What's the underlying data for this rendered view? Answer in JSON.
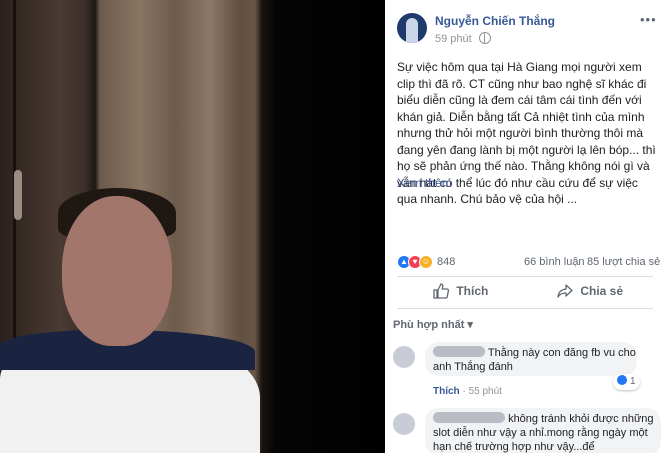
{
  "post": {
    "author": "Nguyễn Chiến Thắng",
    "time": "59 phút",
    "more_icon": "ellipsis-icon",
    "text": "Sự việc hôm qua tại Hà Giang mọi người xem clip thì đã rõ. CT cũng như bao nghệ sĩ khác đi biểu diễn cũng là đem cái tâm cái tình đến với khán giả. Diễn bằng tất Cả nhiệt tình của mình nhưng thử hỏi một người bình thường thôi mà đang yên đang lành bị một người lạ lên bóp... thì họ sẽ phản ứng thế nào. Thằng không nói gì và vẫn hát có thể lúc đó như cầu cứu để sự việc qua nhanh. Chú bảo vệ của hội ...",
    "see_more": "Xem thêm"
  },
  "reactions": {
    "count": "848",
    "comments": "66 bình luận",
    "shares": "85 lượt chia sẻ"
  },
  "actions": {
    "like": "Thích",
    "share": "Chia sẻ"
  },
  "comments_sort": "Phù hợp nhất ▾",
  "comments": [
    {
      "text": "Thằng này con đăng fb vu cho anh Thắng đánh",
      "like": "Thích",
      "time": "55 phút",
      "likes": "1"
    },
    {
      "text": "không tránh khỏi được những slot diễn như vậy a nhỉ.mong rằng ngày một hạn chế trường hợp như vậy...để"
    }
  ],
  "colors": {
    "link": "#385898",
    "like_blue": "#2078f4",
    "love_red": "#f33e58",
    "haha_yellow": "#f7b125"
  }
}
